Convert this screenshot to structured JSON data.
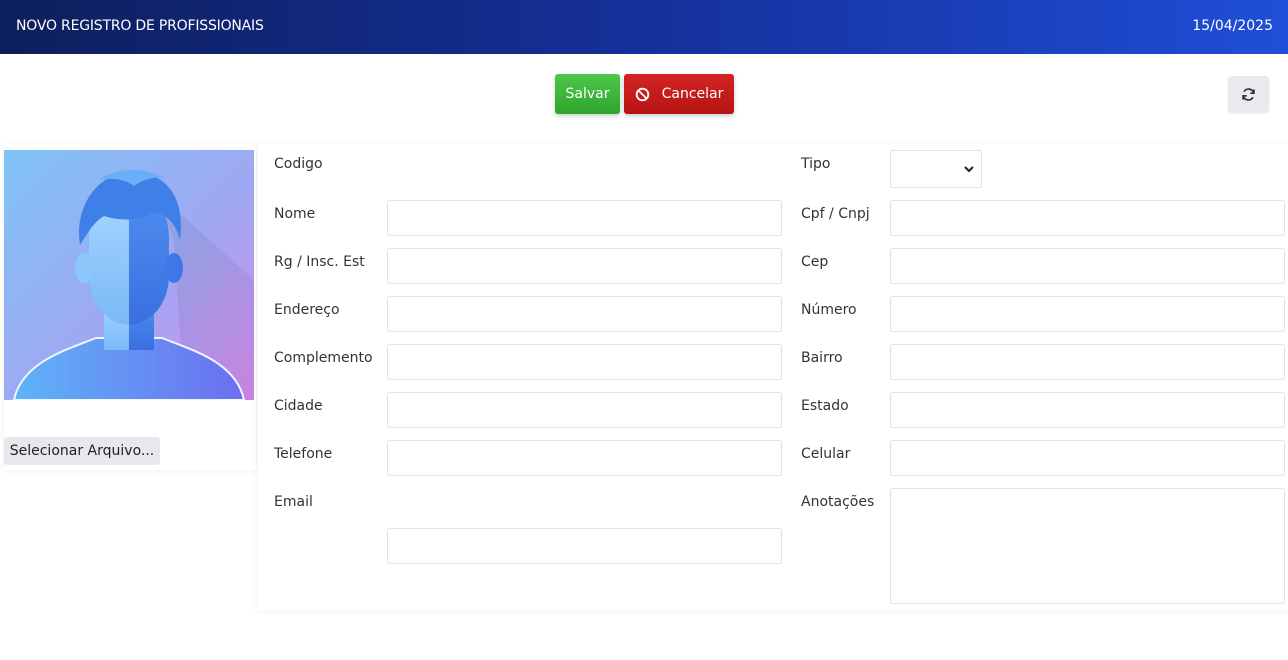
{
  "header": {
    "title": "NOVO REGISTRO DE PROFISSIONAIS",
    "date": "15/04/2025"
  },
  "toolbar": {
    "save_label": "Salvar",
    "cancel_label": "Cancelar",
    "refresh_icon": "refresh-icon",
    "cancel_icon": "ban-icon"
  },
  "photo": {
    "avatar_icon": "avatar-silhouette",
    "file_button_label": "Selecionar Arquivo..."
  },
  "form": {
    "codigo": {
      "label": "Codigo"
    },
    "tipo": {
      "label": "Tipo",
      "value": ""
    },
    "nome": {
      "label": "Nome",
      "value": ""
    },
    "cpf_cnpj": {
      "label": "Cpf / Cnpj",
      "value": ""
    },
    "rg": {
      "label": "Rg / Insc. Est",
      "value": ""
    },
    "cep": {
      "label": "Cep",
      "value": ""
    },
    "endereco": {
      "label": "Endereço",
      "value": ""
    },
    "numero": {
      "label": "Número",
      "value": ""
    },
    "complemento": {
      "label": "Complemento",
      "value": ""
    },
    "bairro": {
      "label": "Bairro",
      "value": ""
    },
    "cidade": {
      "label": "Cidade",
      "value": ""
    },
    "estado": {
      "label": "Estado",
      "value": ""
    },
    "telefone": {
      "label": "Telefone",
      "value": ""
    },
    "celular": {
      "label": "Celular",
      "value": ""
    },
    "email": {
      "label": "Email",
      "value": ""
    },
    "anotacoes": {
      "label": "Anotações",
      "value": ""
    }
  },
  "colors": {
    "header_start": "#0d1f5c",
    "header_end": "#1f4ed8",
    "save": "#3bb83a",
    "cancel": "#c41c1c"
  }
}
